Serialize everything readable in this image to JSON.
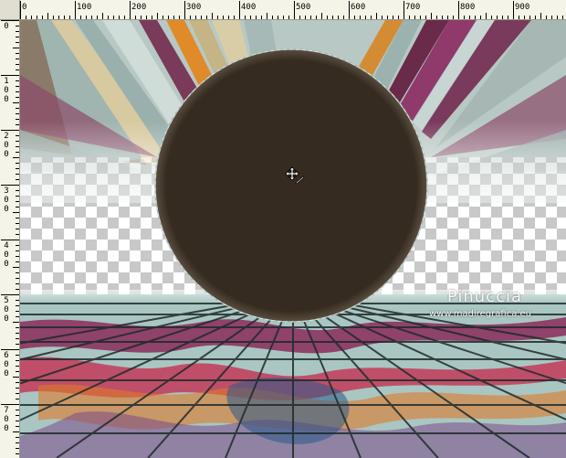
{
  "ruler": {
    "top_labels": [
      "0",
      "100",
      "200",
      "300",
      "400",
      "500",
      "600",
      "700",
      "800",
      "900"
    ],
    "left_labels": [
      "0",
      "100",
      "200",
      "300",
      "400",
      "500",
      "600",
      "700"
    ]
  },
  "watermark": {
    "name": "Pinuccia",
    "url": "www.madiregrafica.eu"
  },
  "colors": {
    "circle_fill": "#352b20",
    "ruler_bg": "#f4f4e8",
    "checker_light": "#ffffff",
    "checker_dark": "#c8c8c8"
  },
  "icons": {
    "cursor": "move-cursor-icon"
  }
}
